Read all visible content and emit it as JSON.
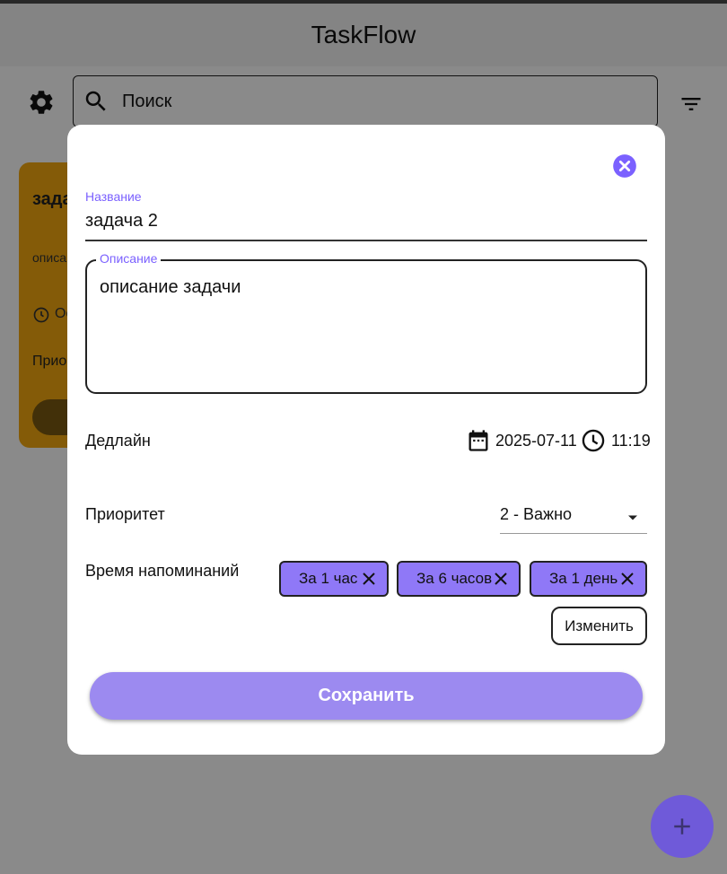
{
  "app": {
    "title": "TaskFlow"
  },
  "toolbar": {
    "search_placeholder": "Поиск"
  },
  "background_card": {
    "title": "задач",
    "description": "описан",
    "deadline": "Ос",
    "priority": "Приор"
  },
  "dialog": {
    "name_label": "Название",
    "name_value": "задача 2",
    "description_label": "Описание",
    "description_value": "описание задачи",
    "deadline_label": "Дедлайн",
    "deadline_date": "2025-07-11",
    "deadline_time": "11:19",
    "priority_label": "Приоритет",
    "priority_value": "2 - Важно",
    "reminders_label": "Время напоминаний",
    "reminders": [
      {
        "label": "За 1 час"
      },
      {
        "label": "За 6 часов"
      },
      {
        "label": "За 1 день"
      }
    ],
    "change_label": "Изменить",
    "save_label": "Сохранить"
  },
  "colors": {
    "accent": "#7b61ff",
    "chip": "#8f78f7",
    "save_button": "#9c8af0",
    "fab": "#6f5ad9",
    "card": "#f4a90f"
  }
}
